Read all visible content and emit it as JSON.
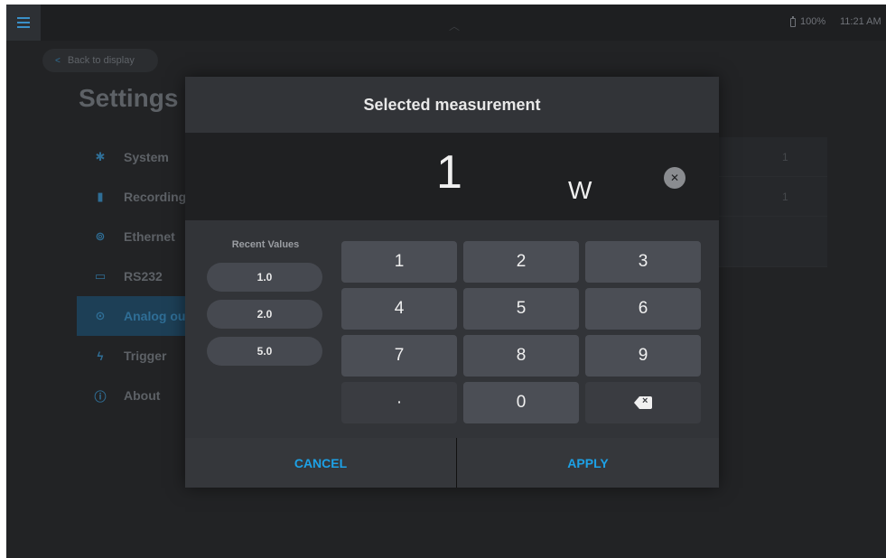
{
  "status": {
    "battery": "100%",
    "time": "11:21 AM"
  },
  "back_label": "Back to display",
  "settings_title": "Settings",
  "sidebar": {
    "items": [
      {
        "label": "System",
        "icon": "gear-icon"
      },
      {
        "label": "Recording",
        "icon": "file-icon"
      },
      {
        "label": "Ethernet",
        "icon": "antenna-icon"
      },
      {
        "label": "RS232",
        "icon": "serial-port-icon"
      },
      {
        "label": "Analog ou",
        "icon": "circle-icon"
      },
      {
        "label": "Trigger",
        "icon": "lightning-icon"
      },
      {
        "label": "About",
        "icon": "info-icon"
      }
    ]
  },
  "right_panel": {
    "values": [
      "1",
      "1"
    ]
  },
  "dialog": {
    "title": "Selected measurement",
    "value": "1",
    "unit": "W",
    "recent_title": "Recent Values",
    "recent": [
      "1.0",
      "2.0",
      "5.0"
    ],
    "keys": [
      "1",
      "2",
      "3",
      "4",
      "5",
      "6",
      "7",
      "8",
      "9",
      "·",
      "0"
    ],
    "cancel": "CANCEL",
    "apply": "APPLY"
  },
  "colors": {
    "accent": "#1da1e6",
    "background": "#222325",
    "dialog": "#323438"
  }
}
